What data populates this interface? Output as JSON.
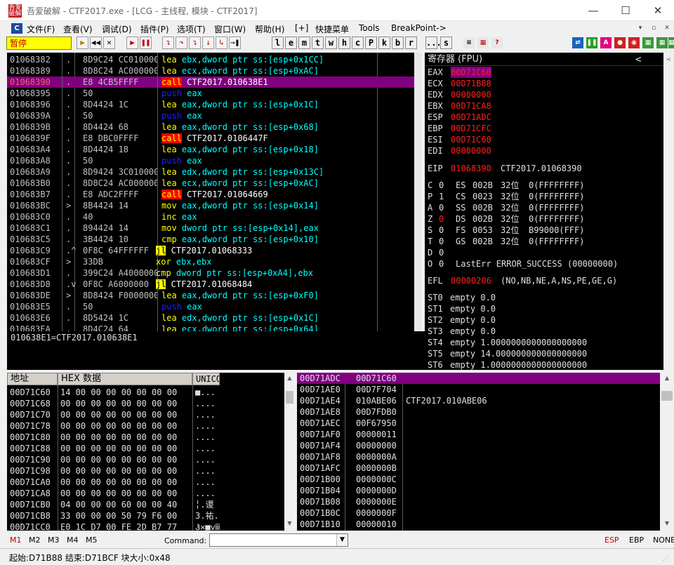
{
  "window": {
    "title": "吾爱破解 - CTF2017.exe - [LCG - 主线程, 模块 - CTF2017]",
    "icon_text": "吾爱破解",
    "minimize": "—",
    "maximize": "☐",
    "close": "✕"
  },
  "menu": {
    "items": [
      "文件(F)",
      "查看(V)",
      "调试(D)",
      "插件(P)",
      "选项(T)",
      "窗口(W)",
      "帮助(H)",
      "[+]",
      "快捷菜单",
      "Tools",
      "BreakPoint->"
    ],
    "icon": "C",
    "mdi": [
      "▾",
      "▫",
      "✕"
    ]
  },
  "toolbar": {
    "status": "暂停",
    "buttons": [
      "▶",
      "◀◀",
      "✕",
      "▶",
      "❚❚",
      "↴",
      "↷",
      "↴",
      "↓",
      "↳",
      "→❚"
    ],
    "letters": [
      "l",
      "e",
      "m",
      "t",
      "w",
      "h",
      "c",
      "P",
      "k",
      "b",
      "r",
      "...",
      "s"
    ],
    "right_icons": [
      "≡",
      "▦",
      "?",
      "⇄",
      "❚❚",
      "A",
      "●",
      "◉",
      "▦",
      "▦",
      "▦"
    ]
  },
  "disasm": {
    "rows": [
      {
        "addr": "01068382",
        "mark": ".",
        "hex": "8D9C24 CC010000",
        "asm": [
          [
            "lea",
            "kw-lea"
          ],
          [
            " ebx,",
            "arg-cyan"
          ],
          [
            "dword ptr ss:[esp+0x1CC]",
            "arg-cyan"
          ]
        ],
        "cur": false
      },
      {
        "addr": "01068389",
        "mark": ".",
        "hex": "8D8C24 AC000000",
        "asm": [
          [
            "lea",
            "kw-lea"
          ],
          [
            " ecx,",
            "arg-cyan"
          ],
          [
            "dword ptr ss:[esp+0xAC]",
            "arg-cyan"
          ]
        ],
        "cur": false
      },
      {
        "addr": "01068390",
        "mark": ".",
        "hex": "E8 4CB5FFFF",
        "asm": [
          [
            "call",
            "kw-call"
          ],
          [
            " CTF2017.010638E1",
            "arg-white"
          ]
        ],
        "cur": true
      },
      {
        "addr": "01068395",
        "mark": ".",
        "hex": "50",
        "asm": [
          [
            "push",
            "kw-push"
          ],
          [
            " eax",
            "arg-cyan"
          ]
        ],
        "cur": false
      },
      {
        "addr": "01068396",
        "mark": ".",
        "hex": "8D4424 1C",
        "asm": [
          [
            "lea",
            "kw-lea"
          ],
          [
            " eax,",
            "arg-cyan"
          ],
          [
            "dword ptr ss:[esp+0x1C]",
            "arg-cyan"
          ]
        ],
        "cur": false
      },
      {
        "addr": "0106839A",
        "mark": ".",
        "hex": "50",
        "asm": [
          [
            "push",
            "kw-push"
          ],
          [
            " eax",
            "arg-cyan"
          ]
        ],
        "cur": false
      },
      {
        "addr": "0106839B",
        "mark": ".",
        "hex": "8D4424 68",
        "asm": [
          [
            "lea",
            "kw-lea"
          ],
          [
            " eax,",
            "arg-cyan"
          ],
          [
            "dword ptr ss:[esp+0x68]",
            "arg-cyan"
          ]
        ],
        "cur": false
      },
      {
        "addr": "0106839F",
        "mark": ".",
        "hex": "E8 DBC0FFFF",
        "asm": [
          [
            "call",
            "kw-call"
          ],
          [
            " CTF2017.0106447F",
            "arg-white"
          ]
        ],
        "cur": false
      },
      {
        "addr": "010683A4",
        "mark": ".",
        "hex": "8D4424 18",
        "asm": [
          [
            "lea",
            "kw-lea"
          ],
          [
            " eax,",
            "arg-cyan"
          ],
          [
            "dword ptr ss:[esp+0x18]",
            "arg-cyan"
          ]
        ],
        "cur": false
      },
      {
        "addr": "010683A8",
        "mark": ".",
        "hex": "50",
        "asm": [
          [
            "push",
            "kw-push"
          ],
          [
            " eax",
            "arg-cyan"
          ]
        ],
        "cur": false
      },
      {
        "addr": "010683A9",
        "mark": ".",
        "hex": "8D9424 3C010000",
        "asm": [
          [
            "lea",
            "kw-lea"
          ],
          [
            " edx,",
            "arg-cyan"
          ],
          [
            "dword ptr ss:[esp+0x13C]",
            "arg-cyan"
          ]
        ],
        "cur": false
      },
      {
        "addr": "010683B0",
        "mark": ".",
        "hex": "8D8C24 AC000000",
        "asm": [
          [
            "lea",
            "kw-lea"
          ],
          [
            " ecx,",
            "arg-cyan"
          ],
          [
            "dword ptr ss:[esp+0xAC]",
            "arg-cyan"
          ]
        ],
        "cur": false
      },
      {
        "addr": "010683B7",
        "mark": ".",
        "hex": "E8 ADC2FFFF",
        "asm": [
          [
            "call",
            "kw-call"
          ],
          [
            " CTF2017.01064669",
            "arg-white"
          ]
        ],
        "cur": false
      },
      {
        "addr": "010683BC",
        "mark": ">",
        "hex": "8B4424 14",
        "asm": [
          [
            "mov",
            "kw-mov"
          ],
          [
            " eax,",
            "arg-cyan"
          ],
          [
            "dword ptr ss:[esp+0x14]",
            "arg-cyan"
          ]
        ],
        "cur": false
      },
      {
        "addr": "010683C0",
        "mark": ".",
        "hex": "40",
        "asm": [
          [
            "inc",
            "kw-inc"
          ],
          [
            " eax",
            "arg-cyan"
          ]
        ],
        "cur": false
      },
      {
        "addr": "010683C1",
        "mark": ".",
        "hex": "894424 14",
        "asm": [
          [
            "mov",
            "kw-mov"
          ],
          [
            " dword ptr ss:[esp+0x14],eax",
            "arg-cyan"
          ]
        ],
        "cur": false
      },
      {
        "addr": "010683C5",
        "mark": ".",
        "hex": "3B4424 10",
        "asm": [
          [
            "cmp",
            "kw-cmp"
          ],
          [
            " eax,",
            "arg-cyan"
          ],
          [
            "dword ptr ss:[esp+0x10]",
            "arg-cyan"
          ]
        ],
        "cur": false
      },
      {
        "addr": "010683C9",
        "mark": ".^",
        "hex": "0F8C 64FFFFFF",
        "asm": [
          [
            "jl",
            "kw-j"
          ],
          [
            " CTF2017.01068333",
            "arg-white"
          ]
        ],
        "cur": false,
        "indent": -8
      },
      {
        "addr": "010683CF",
        "mark": ">",
        "hex": "33DB",
        "asm": [
          [
            "xor",
            "kw-xor"
          ],
          [
            " ebx,ebx",
            "arg-cyan"
          ]
        ],
        "cur": false,
        "indent": -8
      },
      {
        "addr": "010683D1",
        "mark": ".",
        "hex": "399C24 A4000000",
        "asm": [
          [
            "cmp",
            "kw-cmp"
          ],
          [
            " dword ptr ss:[esp+0xA4],ebx",
            "arg-cyan"
          ]
        ],
        "cur": false,
        "indent": -8
      },
      {
        "addr": "010683D8",
        "mark": ".v",
        "hex": "0F8C A6000000",
        "asm": [
          [
            "jl",
            "kw-j"
          ],
          [
            " CTF2017.01068484",
            "arg-white"
          ]
        ],
        "cur": false,
        "indent": -8
      },
      {
        "addr": "010683DE",
        "mark": ">",
        "hex": "8D8424 F0000000",
        "asm": [
          [
            "lea",
            "kw-lea"
          ],
          [
            " eax,",
            "arg-cyan"
          ],
          [
            "dword ptr ss:[esp+0xF0]",
            "arg-cyan"
          ]
        ],
        "cur": false
      },
      {
        "addr": "010683E5",
        "mark": ".",
        "hex": "50",
        "asm": [
          [
            "push",
            "kw-push"
          ],
          [
            " eax",
            "arg-cyan"
          ]
        ],
        "cur": false
      },
      {
        "addr": "010683E6",
        "mark": ".",
        "hex": "8D5424 1C",
        "asm": [
          [
            "lea",
            "kw-lea"
          ],
          [
            " edx,",
            "arg-cyan"
          ],
          [
            "dword ptr ss:[esp+0x1C]",
            "arg-cyan"
          ]
        ],
        "cur": false
      },
      {
        "addr": "010683EA",
        "mark": ".",
        "hex": "8D4C24 64",
        "asm": [
          [
            "lea",
            "kw-lea"
          ],
          [
            " ecx,",
            "arg-cyan"
          ],
          [
            "dword ptr ss:[esp+0x64]",
            "arg-cyan"
          ]
        ],
        "cur": false
      }
    ]
  },
  "info_line": "010638E1=CTF2017.010638E1",
  "registers": {
    "header": "寄存器 (FPU)",
    "nav_left": "<",
    "nav_right": "<",
    "gp": [
      {
        "name": "EAX",
        "value": "00D71C60",
        "sel": true
      },
      {
        "name": "ECX",
        "value": "00D71B88"
      },
      {
        "name": "EDX",
        "value": "00000000"
      },
      {
        "name": "EBX",
        "value": "00D71CA8"
      },
      {
        "name": "ESP",
        "value": "00D71ADC"
      },
      {
        "name": "EBP",
        "value": "00D71CFC"
      },
      {
        "name": "ESI",
        "value": "00D71C60"
      },
      {
        "name": "EDI",
        "value": "00000000"
      }
    ],
    "eip": {
      "name": "EIP",
      "value": "01068390",
      "desc": "CTF2017.01068390"
    },
    "flags": [
      {
        "f": "C",
        "v": "0",
        "seg": "ES",
        "sel": "002B",
        "bits": "32位",
        "info": "0(FFFFFFFF)"
      },
      {
        "f": "P",
        "v": "1",
        "seg": "CS",
        "sel": "0023",
        "bits": "32位",
        "info": "0(FFFFFFFF)"
      },
      {
        "f": "A",
        "v": "0",
        "seg": "SS",
        "sel": "002B",
        "bits": "32位",
        "info": "0(FFFFFFFF)"
      },
      {
        "f": "Z",
        "v": "0",
        "seg": "DS",
        "sel": "002B",
        "bits": "32位",
        "info": "0(FFFFFFFF)",
        "red": true
      },
      {
        "f": "S",
        "v": "0",
        "seg": "FS",
        "sel": "0053",
        "bits": "32位",
        "info": "B99000(FFF)"
      },
      {
        "f": "T",
        "v": "0",
        "seg": "GS",
        "sel": "002B",
        "bits": "32位",
        "info": "0(FFFFFFFF)"
      },
      {
        "f": "D",
        "v": "0"
      },
      {
        "f": "O",
        "v": "0",
        "lasterr": "LastErr ERROR_SUCCESS (00000000)"
      }
    ],
    "efl": {
      "name": "EFL",
      "value": "00000206",
      "desc": "(NO,NB,NE,A,NS,PE,GE,G)"
    },
    "fpu": [
      {
        "name": "ST0",
        "val": "empty 0.0"
      },
      {
        "name": "ST1",
        "val": "empty 0.0"
      },
      {
        "name": "ST2",
        "val": "empty 0.0"
      },
      {
        "name": "ST3",
        "val": "empty 0.0"
      },
      {
        "name": "ST4",
        "val": "empty 1.0000000000000000000"
      },
      {
        "name": "ST5",
        "val": "empty 14.000000000000000000"
      },
      {
        "name": "ST6",
        "val": "empty 1.0000000000000000000"
      }
    ]
  },
  "dump": {
    "col_addr": "地址",
    "col_hex": "HEX 数据",
    "col_uni": "UNICO",
    "rows": [
      {
        "addr": "00D71C60",
        "hex": "14 00 00 00 00 00 00 00",
        "uni": "■..."
      },
      {
        "addr": "00D71C68",
        "hex": "00 00 00 00 00 00 00 00",
        "uni": "...."
      },
      {
        "addr": "00D71C70",
        "hex": "00 00 00 00 00 00 00 00",
        "uni": "...."
      },
      {
        "addr": "00D71C78",
        "hex": "00 00 00 00 00 00 00 00",
        "uni": "...."
      },
      {
        "addr": "00D71C80",
        "hex": "00 00 00 00 00 00 00 00",
        "uni": "...."
      },
      {
        "addr": "00D71C88",
        "hex": "00 00 00 00 00 00 00 00",
        "uni": "...."
      },
      {
        "addr": "00D71C90",
        "hex": "00 00 00 00 00 00 00 00",
        "uni": "...."
      },
      {
        "addr": "00D71C98",
        "hex": "00 00 00 00 00 00 00 00",
        "uni": "...."
      },
      {
        "addr": "00D71CA0",
        "hex": "00 00 00 00 00 00 00 00",
        "uni": "...."
      },
      {
        "addr": "00D71CA8",
        "hex": "00 00 00 00 00 00 00 00",
        "uni": "...."
      },
      {
        "addr": "00D71CB0",
        "hex": "04 00 00 00 60 00 00 40",
        "uni": "╎.谡"
      },
      {
        "addr": "00D71CB8",
        "hex": "33 00 00 00 50 79 F6 00",
        "uni": "3.祐."
      },
      {
        "addr": "00D71CC0",
        "hex": "E0 1C D7 00 FE 2D B7 77",
        "uni": "Ჰ✕■ⅷ"
      }
    ]
  },
  "stack": {
    "rows": [
      {
        "addr": "00D71ADC",
        "val": "00D71C60",
        "comment": "",
        "sel": true
      },
      {
        "addr": "00D71AE0",
        "val": "00D7F704",
        "comment": ""
      },
      {
        "addr": "00D71AE4",
        "val": "010ABE06",
        "comment": "CTF2017.010ABE06"
      },
      {
        "addr": "00D71AE8",
        "val": "00D7FDB0",
        "comment": ""
      },
      {
        "addr": "00D71AEC",
        "val": "00F67950",
        "comment": ""
      },
      {
        "addr": "00D71AF0",
        "val": "00000011",
        "comment": ""
      },
      {
        "addr": "00D71AF4",
        "val": "00000000",
        "comment": ""
      },
      {
        "addr": "00D71AF8",
        "val": "0000000A",
        "comment": ""
      },
      {
        "addr": "00D71AFC",
        "val": "0000000B",
        "comment": ""
      },
      {
        "addr": "00D71B00",
        "val": "0000000C",
        "comment": ""
      },
      {
        "addr": "00D71B04",
        "val": "0000000D",
        "comment": ""
      },
      {
        "addr": "00D71B08",
        "val": "0000000E",
        "comment": ""
      },
      {
        "addr": "00D71B0C",
        "val": "0000000F",
        "comment": ""
      },
      {
        "addr": "00D71B10",
        "val": "00000010",
        "comment": ""
      }
    ]
  },
  "bottom": {
    "tabs": [
      "M1",
      "M2",
      "M3",
      "M4",
      "M5"
    ],
    "command_label": "Command:",
    "command_value": "",
    "right": [
      "ESP",
      "EBP",
      "NONE"
    ]
  },
  "status": "起始:D71B88 结束:D71BCF 块大小:0x48"
}
